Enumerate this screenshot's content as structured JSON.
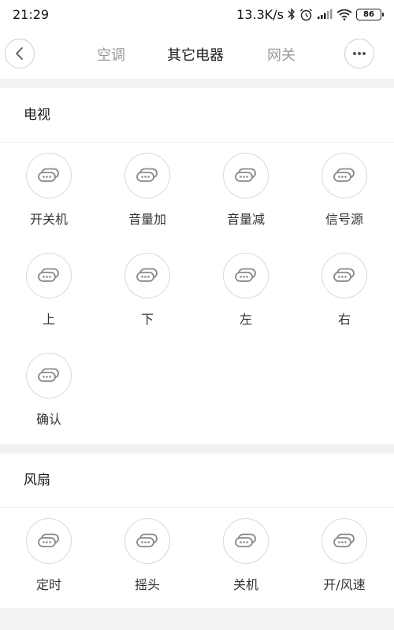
{
  "status_bar": {
    "time": "21:29",
    "speed": "13.3K/s",
    "battery": "86"
  },
  "header": {
    "tabs": [
      {
        "label": "空调"
      },
      {
        "label": "其它电器"
      },
      {
        "label": "网关"
      }
    ]
  },
  "sections": {
    "tv": {
      "title": "电视",
      "buttons": [
        {
          "label": "开关机"
        },
        {
          "label": "音量加"
        },
        {
          "label": "音量减"
        },
        {
          "label": "信号源"
        },
        {
          "label": "上"
        },
        {
          "label": "下"
        },
        {
          "label": "左"
        },
        {
          "label": "右"
        },
        {
          "label": "确认"
        }
      ]
    },
    "fan": {
      "title": "风扇",
      "buttons": [
        {
          "label": "定时"
        },
        {
          "label": "摇头"
        },
        {
          "label": "关机"
        },
        {
          "label": "开/风速"
        }
      ]
    }
  }
}
